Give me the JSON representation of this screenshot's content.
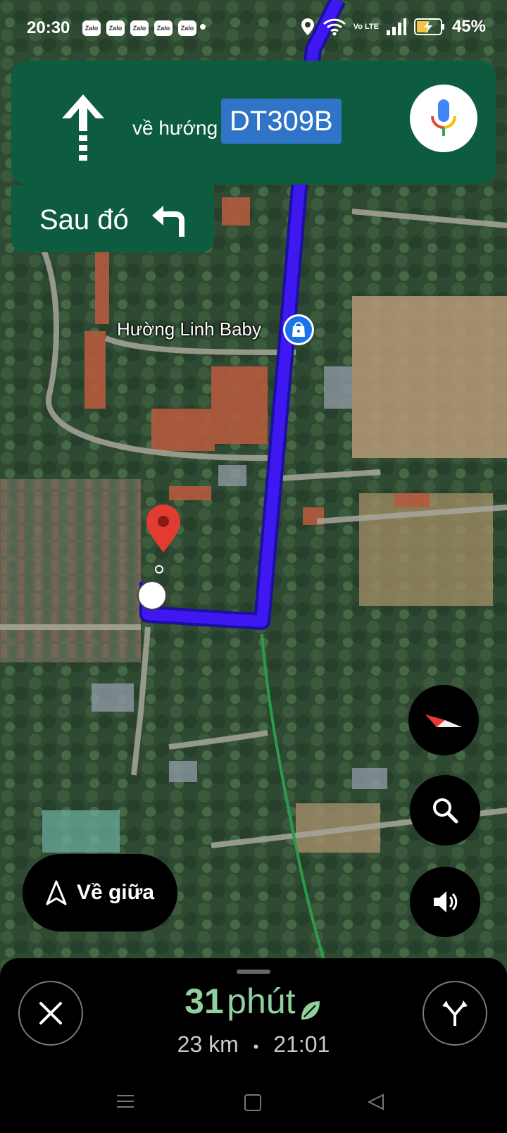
{
  "status_bar": {
    "time": "20:30",
    "notification_icons": [
      "Zalo",
      "Zalo",
      "Zalo",
      "Zalo",
      "Zalo"
    ],
    "network": "Vo LTE",
    "battery": "45%"
  },
  "navigation": {
    "toward_label": "về hướng",
    "road_name": "DT309B",
    "then_label": "Sau đó",
    "next_turn_icon": "turn-left-icon",
    "current_turn_icon": "straight-arrow-icon"
  },
  "map": {
    "poi_name": "Hường Linh Baby",
    "poi_icon": "shopping-bag-icon",
    "route_color": "#3d18f0"
  },
  "controls": {
    "recenter_label": "Về giữa",
    "compass_icon": "compass-icon",
    "search_icon": "search-icon",
    "sound_icon": "volume-icon"
  },
  "trip": {
    "eta_value": "31",
    "eta_unit": "phút",
    "distance": "23 km",
    "separator": "•",
    "arrival_time": "21:01",
    "eta_color": "#8fd19e"
  }
}
